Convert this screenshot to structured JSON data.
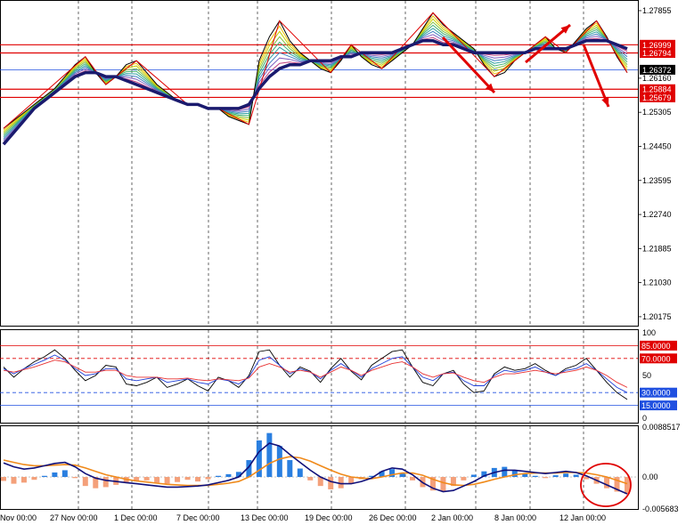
{
  "colors": {
    "up_red": "#e00000",
    "ema_dark": "#1a1a6e",
    "price_line": "#000000",
    "rsi_black": "#000000",
    "rsi_blue": "#1f3fd8",
    "rsi_red": "#e83030",
    "macd_pos": "#2a7fe0",
    "macd_neg": "#f4a07a",
    "macd_line": "#10107a",
    "signal_line": "#f08a1a",
    "level_red": "#e00000",
    "level_blue": "#2050e0",
    "badge_black": "#000000"
  },
  "chart_data": [
    {
      "type": "line",
      "panel": "price",
      "yticks": [
        "1.27855",
        "1.26999",
        "1.26794",
        "1.26372",
        "1.26160",
        "1.25884",
        "1.25679",
        "1.25305",
        "1.24450",
        "1.23595",
        "1.22740",
        "1.21885",
        "1.21030",
        "1.20175"
      ],
      "ylim": [
        1.1995,
        1.281
      ],
      "levels": [
        1.26999,
        1.26794,
        1.25884,
        1.25679
      ],
      "current_price": 1.26372,
      "close": [
        1.249,
        1.251,
        1.253,
        1.255,
        1.257,
        1.259,
        1.262,
        1.265,
        1.267,
        1.263,
        1.26,
        1.262,
        1.265,
        1.266,
        1.263,
        1.26,
        1.258,
        1.256,
        1.255,
        1.255,
        1.254,
        1.254,
        1.252,
        1.251,
        1.25,
        1.266,
        1.272,
        1.276,
        1.271,
        1.268,
        1.266,
        1.264,
        1.263,
        1.266,
        1.27,
        1.267,
        1.265,
        1.264,
        1.266,
        1.268,
        1.27,
        1.274,
        1.278,
        1.275,
        1.273,
        1.271,
        1.269,
        1.265,
        1.262,
        1.263,
        1.266,
        1.268,
        1.27,
        1.272,
        1.269,
        1.268,
        1.271,
        1.274,
        1.276,
        1.272,
        1.267,
        1.263
      ],
      "ema": [
        1.245,
        1.248,
        1.251,
        1.254,
        1.256,
        1.258,
        1.26,
        1.262,
        1.263,
        1.263,
        1.262,
        1.262,
        1.261,
        1.26,
        1.259,
        1.258,
        1.257,
        1.256,
        1.255,
        1.255,
        1.254,
        1.254,
        1.254,
        1.254,
        1.255,
        1.259,
        1.262,
        1.264,
        1.265,
        1.265,
        1.266,
        1.266,
        1.266,
        1.267,
        1.267,
        1.268,
        1.268,
        1.268,
        1.268,
        1.269,
        1.27,
        1.271,
        1.271,
        1.27,
        1.27,
        1.269,
        1.268,
        1.268,
        1.268,
        1.268,
        1.268,
        1.268,
        1.269,
        1.269,
        1.269,
        1.269,
        1.27,
        1.271,
        1.271,
        1.271,
        1.27,
        1.269
      ]
    },
    {
      "type": "line",
      "panel": "rsi",
      "ylim": [
        0,
        100
      ],
      "yticks": [
        "100",
        "70",
        "50",
        "30",
        "0"
      ],
      "levels": [
        85,
        70,
        30,
        15
      ],
      "level_labels": [
        "85.0000",
        "70.0000",
        "30.0000",
        "15.0000"
      ],
      "series": [
        {
          "values": [
            60,
            48,
            58,
            66,
            72,
            80,
            70,
            56,
            44,
            50,
            62,
            60,
            40,
            38,
            42,
            48,
            36,
            40,
            46,
            38,
            32,
            48,
            44,
            36,
            50,
            78,
            80,
            62,
            48,
            60,
            55,
            42,
            58,
            70,
            55,
            45,
            62,
            70,
            78,
            80,
            60,
            42,
            38,
            52,
            56,
            40,
            30,
            32,
            52,
            60,
            56,
            58,
            64,
            56,
            50,
            58,
            62,
            70,
            56,
            42,
            30,
            22
          ]
        },
        {
          "values": [
            58,
            52,
            58,
            63,
            68,
            74,
            68,
            58,
            50,
            52,
            58,
            58,
            46,
            44,
            46,
            48,
            42,
            44,
            46,
            42,
            40,
            46,
            44,
            40,
            48,
            68,
            72,
            62,
            52,
            58,
            54,
            46,
            56,
            64,
            56,
            48,
            58,
            64,
            70,
            72,
            60,
            48,
            44,
            52,
            54,
            44,
            38,
            38,
            50,
            56,
            54,
            56,
            60,
            54,
            50,
            56,
            58,
            64,
            56,
            46,
            36,
            30
          ]
        },
        {
          "values": [
            56,
            54,
            57,
            60,
            64,
            68,
            66,
            60,
            54,
            54,
            56,
            56,
            50,
            48,
            48,
            48,
            46,
            46,
            47,
            45,
            44,
            46,
            45,
            44,
            47,
            60,
            64,
            60,
            54,
            56,
            54,
            48,
            54,
            60,
            56,
            50,
            56,
            60,
            64,
            66,
            60,
            52,
            48,
            52,
            53,
            48,
            44,
            42,
            48,
            52,
            52,
            54,
            56,
            54,
            52,
            54,
            56,
            60,
            56,
            50,
            42,
            36
          ]
        }
      ]
    },
    {
      "type": "bar",
      "panel": "macd",
      "ylim": [
        -0.005683,
        0.008851
      ],
      "yticks": [
        "0.0088517",
        "0.00",
        "-0.005683"
      ],
      "histogram": [
        -0.0007,
        -0.0012,
        -0.001,
        -0.0005,
        0.0002,
        0.0008,
        0.0012,
        -0.0002,
        -0.0016,
        -0.002,
        -0.0018,
        -0.0014,
        -0.001,
        -0.0008,
        -0.0006,
        -0.001,
        -0.0012,
        -0.0009,
        -0.0005,
        -0.0008,
        -0.0004,
        0.0002,
        0.0005,
        0.0009,
        0.003,
        0.0065,
        0.0078,
        0.0055,
        0.003,
        0.0015,
        -0.0006,
        -0.0016,
        -0.0022,
        -0.002,
        -0.0012,
        -0.0004,
        0.0002,
        0.001,
        0.0014,
        0.0006,
        -0.0006,
        -0.0018,
        -0.0024,
        -0.0026,
        -0.0016,
        -0.0006,
        0.0004,
        0.001,
        0.0016,
        0.0018,
        0.0012,
        0.0006,
        0.0002,
        -0.0002,
        0.0003,
        0.0006,
        0.0004,
        -0.0004,
        -0.0012,
        -0.002,
        -0.0026,
        -0.003
      ],
      "macd": [
        0.0025,
        0.0018,
        0.0014,
        0.0016,
        0.002,
        0.0024,
        0.0026,
        0.0018,
        0.0006,
        -0.0002,
        -0.0006,
        -0.0008,
        -0.001,
        -0.0012,
        -0.0014,
        -0.0016,
        -0.0018,
        -0.0018,
        -0.0017,
        -0.0016,
        -0.0014,
        -0.001,
        -0.0006,
        0.0,
        0.0018,
        0.0045,
        0.006,
        0.0055,
        0.004,
        0.0026,
        0.0012,
        0.0,
        -0.0008,
        -0.0012,
        -0.0012,
        -0.0008,
        -0.0002,
        0.001,
        0.0016,
        0.0014,
        0.0004,
        -0.001,
        -0.002,
        -0.0026,
        -0.0024,
        -0.0016,
        -0.0008,
        0.0002,
        0.0008,
        0.0012,
        0.0012,
        0.001,
        0.0008,
        0.0006,
        0.0008,
        0.001,
        0.0008,
        0.0002,
        -0.0006,
        -0.0014,
        -0.0022,
        -0.003
      ],
      "signal": [
        0.003,
        0.0026,
        0.0022,
        0.002,
        0.002,
        0.0021,
        0.0022,
        0.0021,
        0.0016,
        0.001,
        0.0004,
        0.0,
        -0.0004,
        -0.0007,
        -0.0009,
        -0.0011,
        -0.0013,
        -0.0014,
        -0.0015,
        -0.0015,
        -0.0015,
        -0.0013,
        -0.0011,
        -0.0008,
        0.0,
        0.0012,
        0.0024,
        0.0032,
        0.0036,
        0.0034,
        0.0028,
        0.002,
        0.0012,
        0.0005,
        0.0,
        -0.0002,
        -0.0003,
        0.0,
        0.0004,
        0.0007,
        0.0007,
        0.0003,
        -0.0004,
        -0.001,
        -0.0014,
        -0.0015,
        -0.0013,
        -0.0009,
        -0.0004,
        0.0,
        0.0004,
        0.0006,
        0.0007,
        0.0007,
        0.0007,
        0.0008,
        0.0008,
        0.0007,
        0.0004,
        0.0,
        -0.0006,
        -0.0012
      ]
    }
  ],
  "x_axis": {
    "labels": [
      "Nov 00:00",
      "27 Nov 00:00",
      "1 Dec 00:00",
      "7 Dec 00:00",
      "13 Dec 00:00",
      "19 Dec 00:00",
      "26 Dec 00:00",
      "2 Jan 00:00",
      "8 Jan 00:00",
      "12 Jan 00:00"
    ]
  }
}
